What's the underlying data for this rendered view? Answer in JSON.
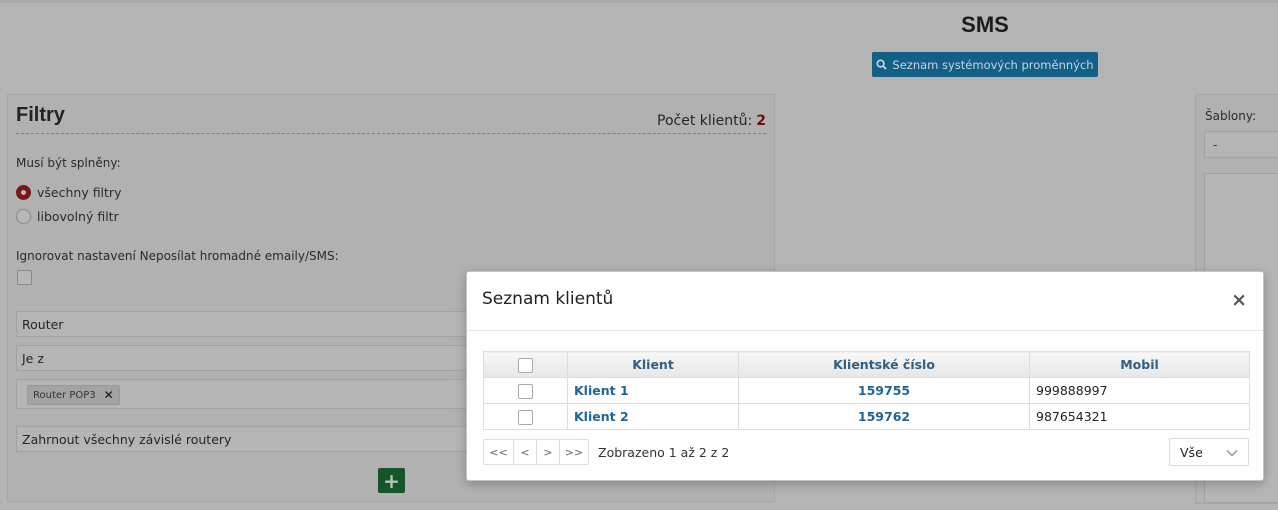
{
  "header": {
    "title": "SMS",
    "sysvars_button": "Seznam systémových proměnných",
    "sysvars_icon": "search-icon"
  },
  "filters": {
    "title": "Filtry",
    "clients_count_label": "Počet klientů:",
    "clients_count": "2",
    "must_be_met_label": "Musí být splněny:",
    "radio_all": "všechny filtry",
    "radio_any": "libovolný filtr",
    "selected_mode": "all",
    "ignore_label": "Ignorovat nastavení Neposílat hromadné emaily/SMS:",
    "field_router": "Router",
    "field_condition": "Je z",
    "tag_value": "Router POP3",
    "field_include": "Zahrnout všechny závislé routery",
    "add_button": "+"
  },
  "templates": {
    "label": "Šablony:",
    "select_value": "-"
  },
  "modal": {
    "title": "Seznam klientů",
    "close": "×",
    "columns": [
      "Klient",
      "Klientské číslo",
      "Mobil"
    ],
    "rows": [
      {
        "client": "Klient 1",
        "number": "159755",
        "mobile": "999888997"
      },
      {
        "client": "Klient 2",
        "number": "159762",
        "mobile": "987654321"
      }
    ],
    "pager": {
      "first": "<<",
      "prev": "<",
      "next": ">",
      "last": ">>",
      "info": "Zobrazeno 1 až 2 z 2",
      "page_size": "Vše"
    }
  },
  "colors": {
    "primary_button": "#1e90c8",
    "accent_red": "#c0282b",
    "add_green": "#1f8f3a",
    "link_blue": "#1f6597"
  }
}
